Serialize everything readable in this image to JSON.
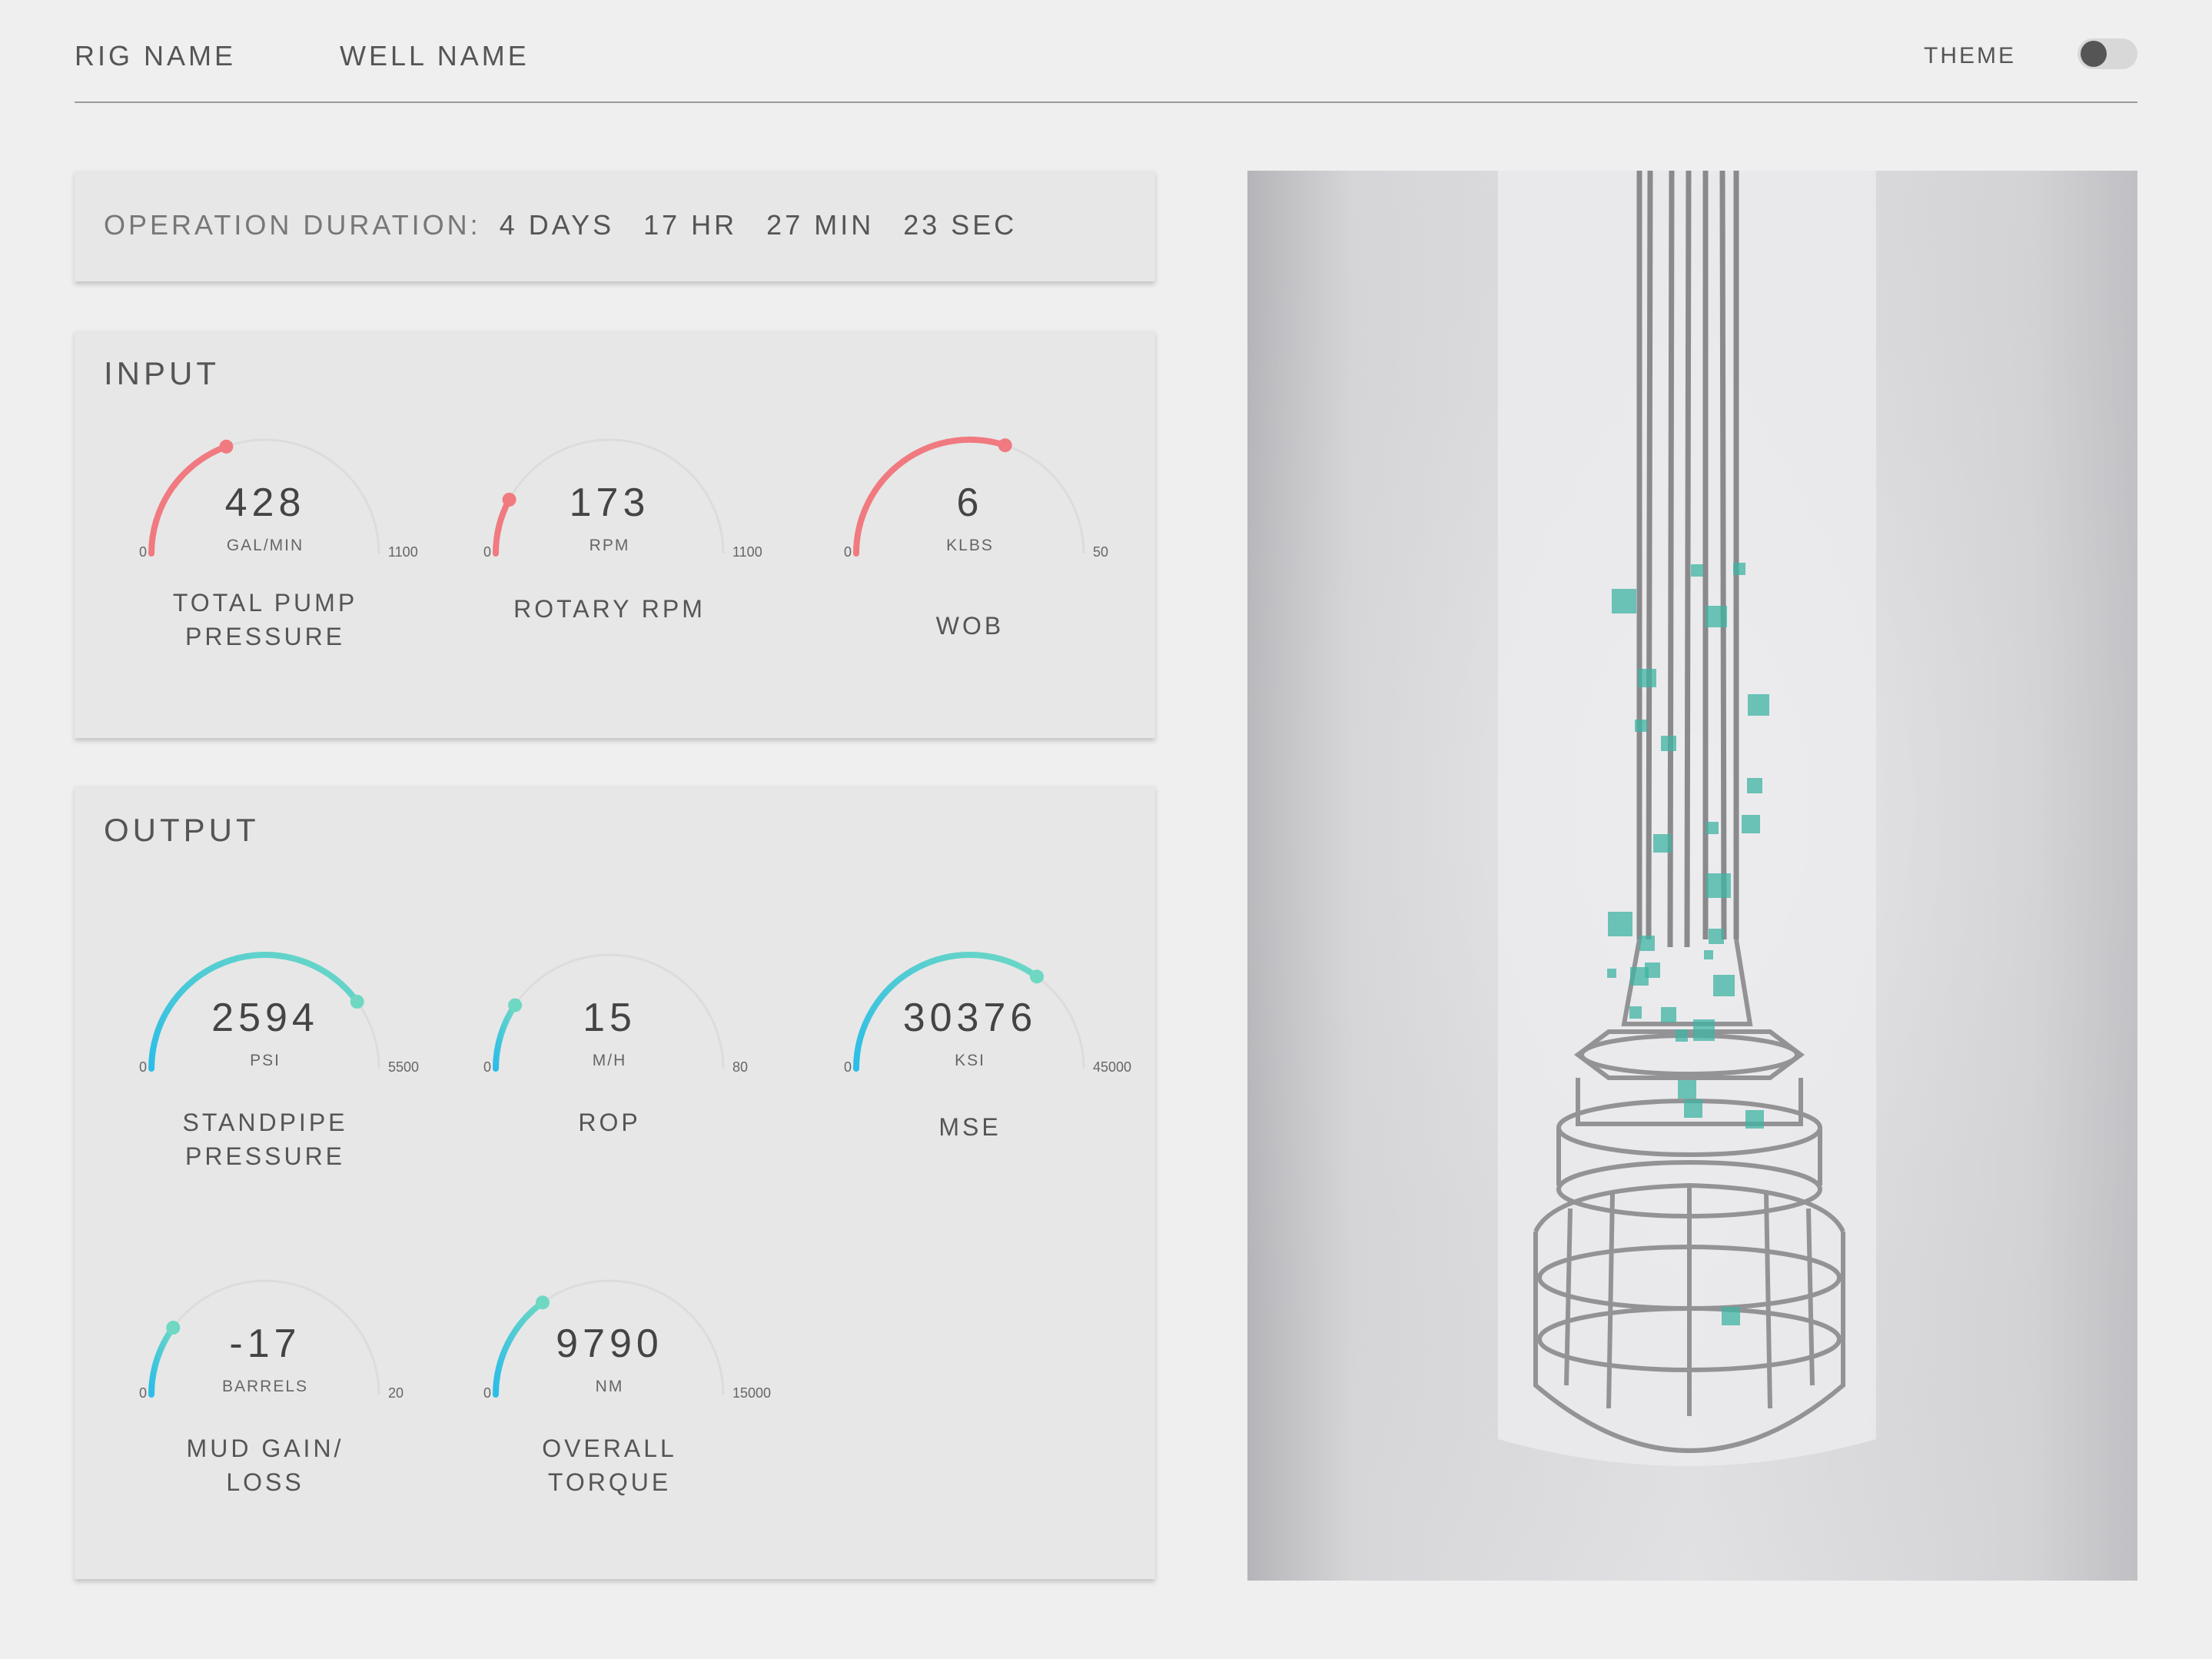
{
  "header": {
    "rig_name": "RIG NAME",
    "well_name": "WELL NAME",
    "theme_label": "THEME",
    "theme_toggle_on": false
  },
  "operation": {
    "label": "OPERATION DURATION:",
    "days": "4 DAYS",
    "hours": "17 HR",
    "minutes": "27 MIN",
    "seconds": "23 SEC"
  },
  "input": {
    "title": "INPUT",
    "gauges": [
      {
        "value": "428",
        "unit": "GAL/MIN",
        "min": "0",
        "max": "1100",
        "label": "TOTAL PUMP PRESSURE",
        "level": 0.389
      },
      {
        "value": "173",
        "unit": "RPM",
        "min": "0",
        "max": "1100",
        "label": "ROTARY RPM",
        "level": 0.157
      },
      {
        "value": "6",
        "unit": "KLBS",
        "min": "0",
        "max": "50",
        "label": "WOB",
        "level": 0.6
      }
    ]
  },
  "output": {
    "title": "OUTPUT",
    "gauges": [
      {
        "value": "2594",
        "unit": "PSI",
        "min": "0",
        "max": "5500",
        "label": "STANDPIPE PRESSURE",
        "level": 0.8
      },
      {
        "value": "15",
        "unit": "M/H",
        "min": "0",
        "max": "80",
        "label": "ROP",
        "level": 0.188
      },
      {
        "value": "30376",
        "unit": "KSI",
        "min": "0",
        "max": "45000",
        "label": "MSE",
        "level": 0.7
      },
      {
        "value": "-17",
        "unit": "BARRELS",
        "min": "0",
        "max": "20",
        "label": "MUD GAIN/ LOSS",
        "level": 0.2
      },
      {
        "value": "9790",
        "unit": "NM",
        "min": "0",
        "max": "15000",
        "label": "OVERALL TORQUE",
        "level": 0.3
      }
    ]
  },
  "colors": {
    "input_arc": "#f07a80",
    "output_arc_start": "#2bbde8",
    "output_arc_end": "#6fd8c3",
    "track": "#dcdcdc",
    "particle": "#3fb3a3"
  }
}
